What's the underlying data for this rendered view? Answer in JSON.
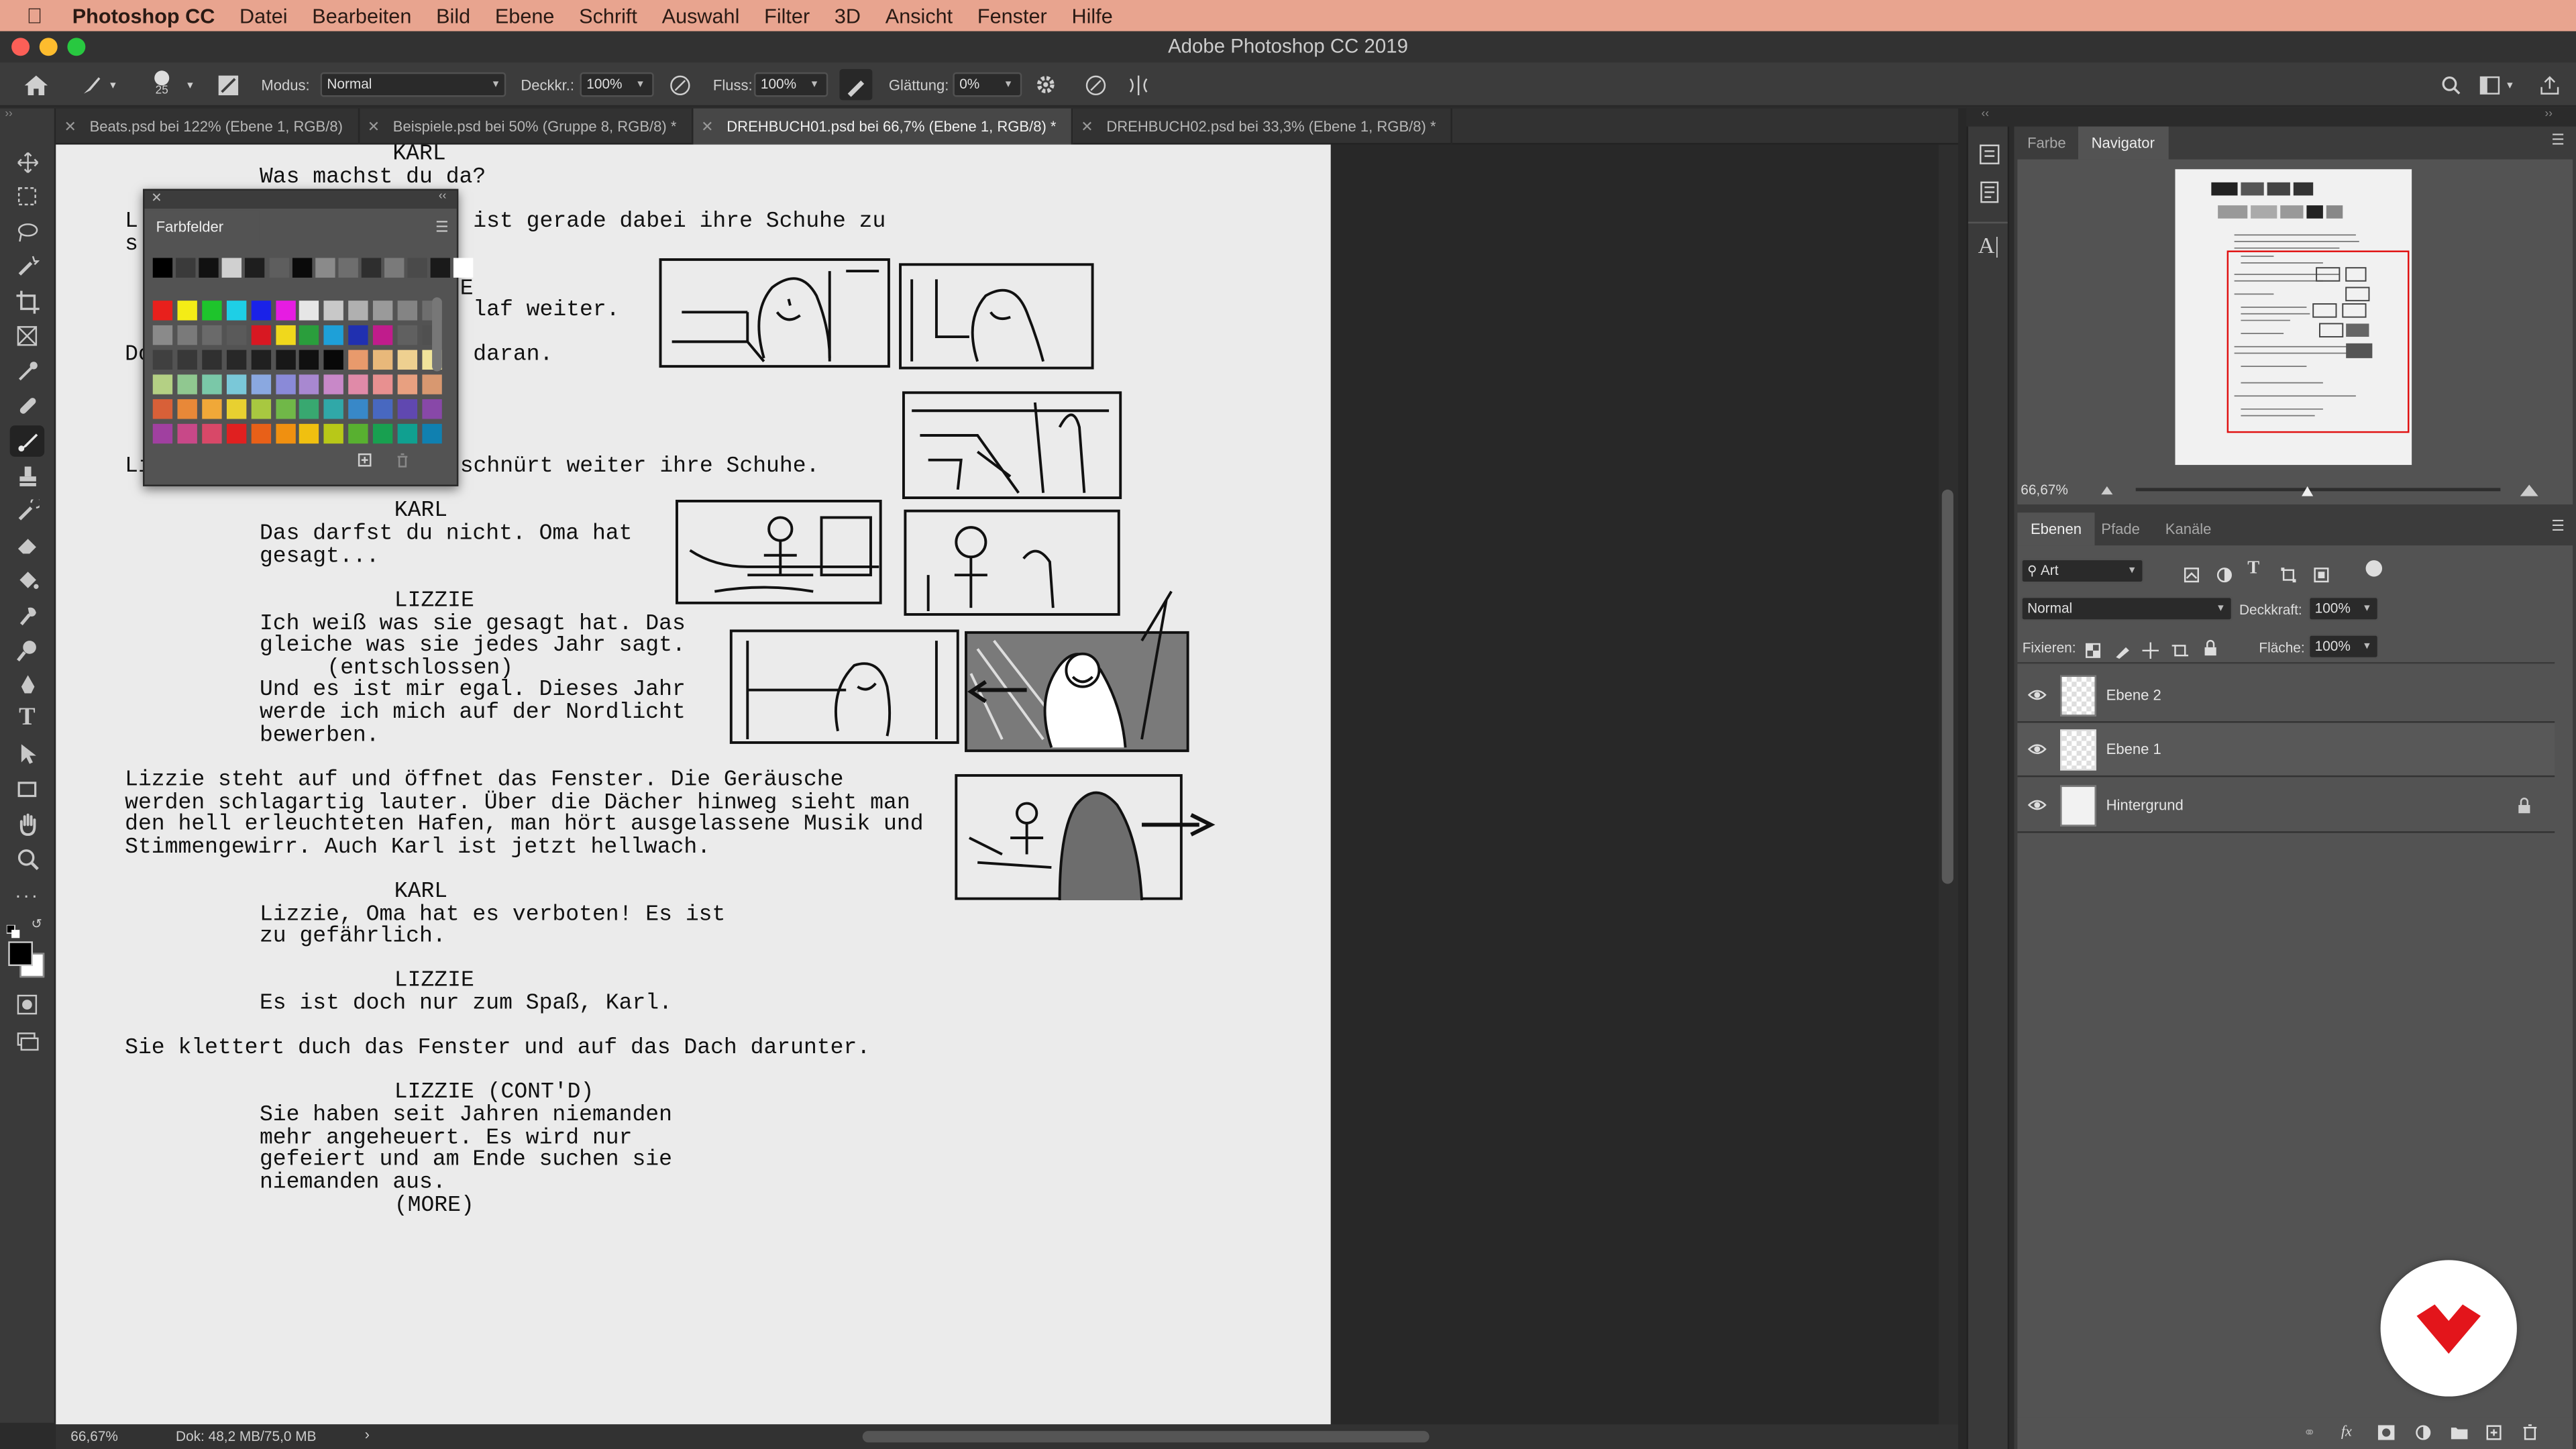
{
  "menubar": {
    "app": "Photoshop CC",
    "items": [
      "Datei",
      "Bearbeiten",
      "Bild",
      "Ebene",
      "Schrift",
      "Auswahl",
      "Filter",
      "3D",
      "Ansicht",
      "Fenster",
      "Hilfe"
    ]
  },
  "window": {
    "title": "Adobe Photoshop CC 2019"
  },
  "options": {
    "brush_size": "25",
    "modus_label": "Modus:",
    "modus_value": "Normal",
    "deckkr_label": "Deckkr.:",
    "deckkr_value": "100%",
    "fluss_label": "Fluss:",
    "fluss_value": "100%",
    "glaettung_label": "Glättung:",
    "glaettung_value": "0%"
  },
  "tabs": [
    {
      "label": "Beats.psd bei 122% (Ebene 1, RGB/8)",
      "active": false
    },
    {
      "label": "Beispiele.psd bei 50% (Gruppe 8, RGB/8) *",
      "active": false
    },
    {
      "label": "DREHBUCH01.psd bei 66,7% (Ebene 1, RGB/8) *",
      "active": true
    },
    {
      "label": "DREHBUCH02.psd bei 33,3% (Ebene 1, RGB/8) *",
      "active": false
    }
  ],
  "script": {
    "l01": "          KARL",
    "l02": "Was machst du da?",
    "l03a": "L",
    "l03b": "ist gerade dabei ihre Schuhe zu",
    "l04": "s",
    "l05": "E",
    "l06": "laf weiter.",
    "l07a": "Do",
    "l07b": "daran.",
    "l08a": "Li",
    "l08b": "schnürt weiter ihre Schuhe.",
    "karl2_name": "KARL",
    "karl2_line1": "Das darfst du nicht. Oma hat",
    "karl2_line2": "gesagt...",
    "lizzie1_name": "LIZZIE",
    "lizzie1_l1": "Ich weiß was sie gesagt hat. Das",
    "lizzie1_l2": "gleiche was sie jedes Jahr sagt.",
    "lizzie1_l3": "(entschlossen)",
    "lizzie1_l4": "Und es ist mir egal. Dieses Jahr",
    "lizzie1_l5": "werde ich mich auf der Nordlicht",
    "lizzie1_l6": "bewerben.",
    "action1_l1": "Lizzie steht auf und öffnet das Fenster. Die Geräusche",
    "action1_l2": "werden schlagartig lauter. Über die Dächer hinweg sieht man",
    "action1_l3": "den hell erleuchteten Hafen, man hört ausgelassene Musik und",
    "action1_l4": "Stimmengewirr. Auch Karl ist jetzt hellwach.",
    "karl3_name": "KARL",
    "karl3_l1": "Lizzie, Oma hat es verboten! Es ist",
    "karl3_l2": "zu gefährlich.",
    "lizzie2_name": "LIZZIE",
    "lizzie2_l1": "Es ist doch nur zum Spaß, Karl.",
    "action2": "Sie klettert duch das Fenster und auf das Dach darunter.",
    "lizzie3_name": "LIZZIE (CONT'D)",
    "lizzie3_l1": "Sie haben seit Jahren niemanden",
    "lizzie3_l2": "mehr angeheuert. Es wird nur",
    "lizzie3_l3": "gefeiert und am Ende suchen sie",
    "lizzie3_l4": "niemanden aus.",
    "more": "(MORE)"
  },
  "swatches_panel": {
    "title": "Farbfelder",
    "rows": [
      [
        "#000000",
        "#3a3a3a",
        "#111111",
        "#d0d0d0",
        "#1e1e1e",
        "#5e5e5e",
        "#0a0a0a",
        "#8a8a8a",
        "#6e6e6e",
        "#2e2e2e",
        "#7a7a7a",
        "#4a4a4a",
        "#1a1a1a",
        "#ffffff"
      ],
      [
        "#e8201c",
        "#f4ec16",
        "#1ec42c",
        "#1ecfe6",
        "#1a22e8",
        "#e61ce2",
        "#e6e6e6",
        "#c8c8c8",
        "#b0b0b0",
        "#9a9a9a",
        "#848484",
        "#6e6e6e"
      ],
      [
        "#8a8a8a",
        "#7a7a7a",
        "#6a6a6a",
        "#5a5a5a",
        "#d81822",
        "#f0d81c",
        "#2a9e3c",
        "#1ea0d8",
        "#2030b0",
        "#c01c8c",
        "#606060",
        "#505050"
      ],
      [
        "#404040",
        "#383838",
        "#303030",
        "#282828",
        "#202020",
        "#181818",
        "#101010",
        "#080808",
        "#e89a6c",
        "#e8b87a",
        "#eed090",
        "#f0e49a"
      ],
      [
        "#b4d084",
        "#90c890",
        "#7ac8a8",
        "#7ac8d8",
        "#8aa8e0",
        "#8a8ad8",
        "#a888d0",
        "#c888c8",
        "#e08aa8",
        "#e89090",
        "#e8a080",
        "#d89870"
      ],
      [
        "#d86038",
        "#e88838",
        "#f0a838",
        "#e8d030",
        "#a8c840",
        "#70b848",
        "#38a870",
        "#30a8a8",
        "#3888c8",
        "#4868c0",
        "#6048b0",
        "#8848a8"
      ],
      [
        "#a040a0",
        "#c84888",
        "#d84868",
        "#e02020",
        "#e86018",
        "#f09010",
        "#f0c010",
        "#b8c818",
        "#58b030",
        "#18a050",
        "#10a090",
        "#1080b0"
      ]
    ]
  },
  "right_panel": {
    "tabs_top": [
      "Farbe",
      "Navigator"
    ],
    "zoom": "66,67%",
    "tabs_layers": [
      "Ebenen",
      "Pfade",
      "Kanäle"
    ],
    "filter_kind": "Art",
    "blend_mode": "Normal",
    "deckkraft_label": "Deckkraft:",
    "deckkraft_value": "100%",
    "fixieren_label": "Fixieren:",
    "flaeche_label": "Fläche:",
    "flaeche_value": "100%",
    "layers": [
      {
        "name": "Ebene 2",
        "selected": false,
        "locked": false
      },
      {
        "name": "Ebene 1",
        "selected": true,
        "locked": false
      },
      {
        "name": "Hintergrund",
        "selected": false,
        "locked": true
      }
    ]
  },
  "status": {
    "zoom": "66,67%",
    "doc": "Dok: 48,2 MB/75,0 MB"
  },
  "colors": {
    "menubar": "#e8a48f",
    "logo_red": "#e3151b",
    "accent": "#e3151b"
  }
}
